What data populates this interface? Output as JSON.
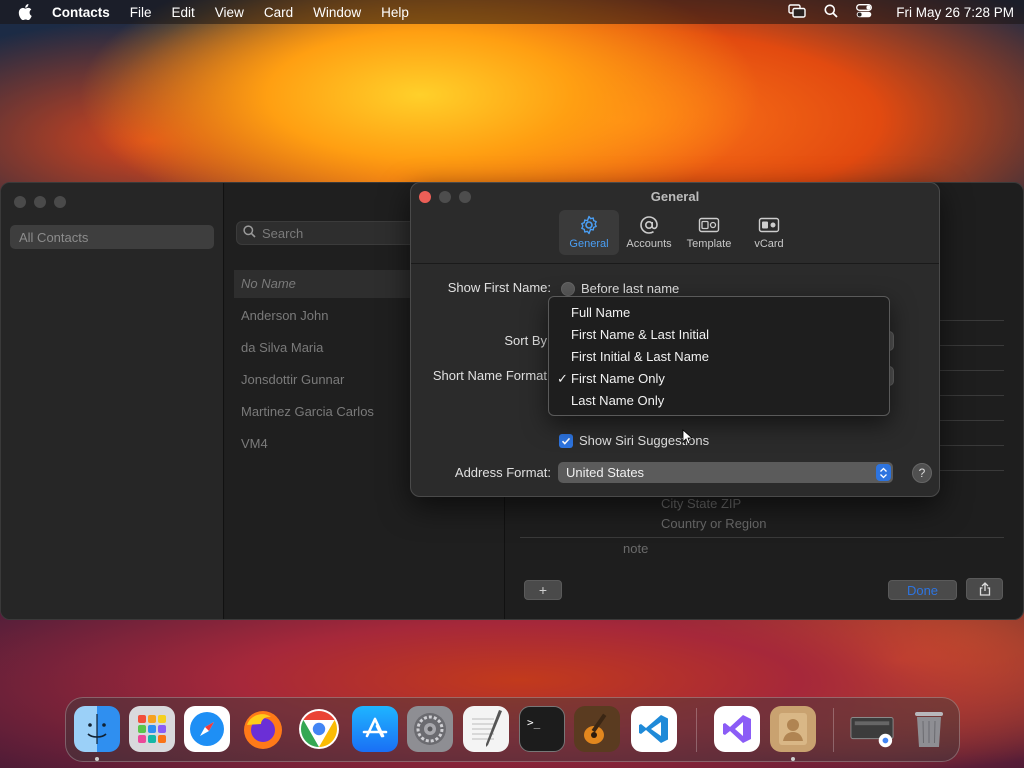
{
  "menubar": {
    "app_name": "Contacts",
    "menus": [
      "File",
      "Edit",
      "View",
      "Card",
      "Window",
      "Help"
    ],
    "clock": "Fri May 26  7:28 PM",
    "icons": [
      "apple-icon",
      "screen-mirroring-icon",
      "search-icon",
      "control-center-icon"
    ]
  },
  "contacts_window": {
    "sidebar": {
      "all_contacts": "All Contacts"
    },
    "search": {
      "placeholder": "Search"
    },
    "contacts": [
      "No Name",
      "Anderson John",
      "da Silva Maria",
      "Jonsdottir Gunnar",
      "Martinez Garcia Carlos",
      "VM4"
    ],
    "selected_contact": "No Name",
    "address_lines": [
      "City State ZIP",
      "Country or Region"
    ],
    "note_label": "note",
    "add_button": "+",
    "done_button": "Done"
  },
  "preferences": {
    "title": "General",
    "tabs": [
      {
        "label": "General",
        "icon": "gear-icon",
        "active": true
      },
      {
        "label": "Accounts",
        "icon": "at-icon",
        "active": false
      },
      {
        "label": "Template",
        "icon": "template-icon",
        "active": false
      },
      {
        "label": "vCard",
        "icon": "vcard-icon",
        "active": false
      }
    ],
    "show_first_name_label": "Show First Name:",
    "show_first_name_option": "Before last name",
    "sort_by_label": "Sort By",
    "short_name_format_label": "Short Name Format",
    "siri_suggestions_label": "Show Siri Suggestions",
    "siri_suggestions_checked": true,
    "address_format_label": "Address Format:",
    "address_format_value": "United States",
    "help_label": "?"
  },
  "dropdown": {
    "items": [
      "Full Name",
      "First Name & Last Initial",
      "First Initial & Last Name",
      "First Name Only",
      "Last Name Only"
    ],
    "checked": "First Name Only",
    "check_mark": "✓"
  },
  "dock": {
    "apps": [
      "Finder",
      "Launchpad",
      "Safari",
      "Firefox",
      "Chrome",
      "App Store",
      "System Settings",
      "TextEdit",
      "Terminal",
      "GarageBand",
      "Visual Studio Code",
      "Visual Studio",
      "Contacts",
      "Chrome Window",
      "Trash"
    ],
    "colors": {
      "finder": "#2f8ff0",
      "safari": "#1e8ff5",
      "appstore": "#1a8cf5",
      "vscode": "#1f8ad8",
      "contacts": "#c9a270"
    }
  }
}
